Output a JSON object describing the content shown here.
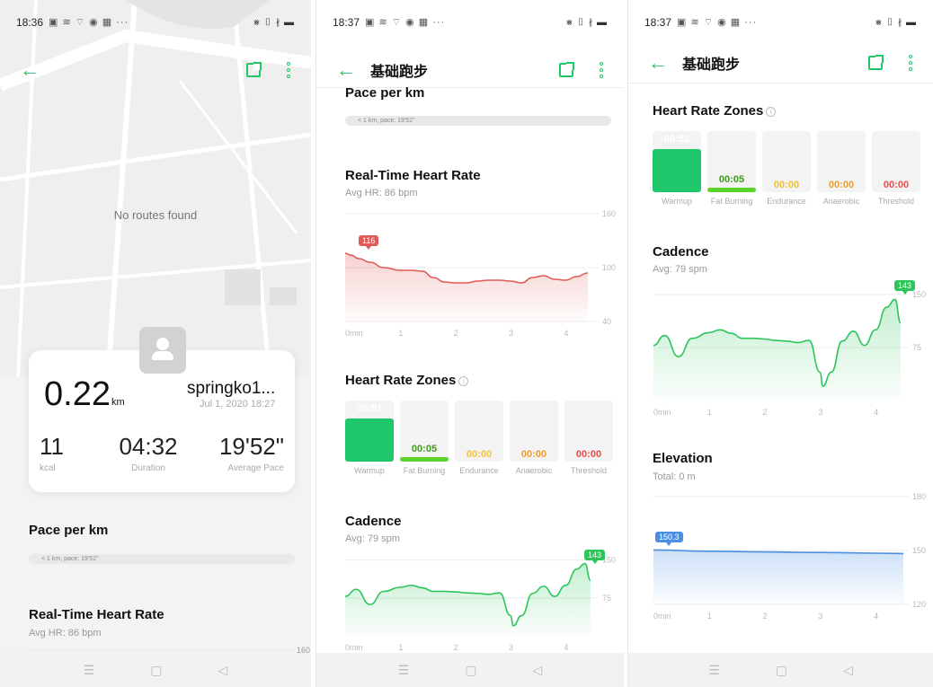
{
  "status": {
    "s1_time": "18:36",
    "s2_time": "18:37",
    "s3_time": "18:37",
    "left_icons": "▣ ≋ ⌔ ◉ ▦ ···",
    "right_icons": "⨳ ▯ ∦ ▬"
  },
  "nav": {
    "title": "基础跑步"
  },
  "map": {
    "no_routes": "No routes found"
  },
  "summary": {
    "distance": "0.22",
    "distance_unit": "km",
    "username": "springko1...",
    "date": "Jul 1, 2020 18:27",
    "kcal_value": "11",
    "kcal_label": "kcal",
    "duration_value": "04:32",
    "duration_label": "Duration",
    "pace_value": "19'52\"",
    "pace_label": "Average Pace"
  },
  "pace": {
    "title": "Pace per km",
    "bar_text": "< 1 km, pace: 19'52\""
  },
  "heart_rate": {
    "title": "Real-Time Heart Rate",
    "avg": "Avg HR: 86 bpm",
    "max_label": "116"
  },
  "zones": {
    "title": "Heart Rate Zones",
    "info": "i",
    "items": [
      {
        "value": "00:51",
        "label": "Warmup",
        "color": "#1ec76a",
        "fraction": 0.7
      },
      {
        "value": "00:05",
        "label": "Fat Burning",
        "color": "#5bd32a",
        "fraction": 0.07
      },
      {
        "value": "00:00",
        "label": "Endurance",
        "color": "#f2c233",
        "fraction": 0
      },
      {
        "value": "00:00",
        "label": "Anaerobic",
        "color": "#f29b2a",
        "fraction": 0
      },
      {
        "value": "00:00",
        "label": "Threshold",
        "color": "#ee4b4b",
        "fraction": 0
      }
    ]
  },
  "cadence": {
    "title": "Cadence",
    "avg": "Avg: 79 spm",
    "max_label": "143"
  },
  "elevation": {
    "title": "Elevation",
    "total": "Total: 0 m",
    "start_label": "150.3"
  },
  "chart_data": [
    {
      "type": "line",
      "title": "Real-Time Heart Rate",
      "x_ticks": [
        "0min",
        "1",
        "2",
        "3",
        "4"
      ],
      "y_ticks": [
        "160",
        "100",
        "40"
      ],
      "ylim": [
        40,
        160
      ],
      "xlim": [
        0,
        4.5
      ],
      "color": "#e05a57",
      "x": [
        0,
        0.1,
        0.25,
        0.45,
        0.7,
        1.0,
        1.2,
        1.4,
        1.6,
        1.8,
        2.0,
        2.2,
        2.4,
        2.6,
        2.8,
        3.0,
        3.2,
        3.4,
        3.6,
        3.8,
        4.0,
        4.2,
        4.4
      ],
      "y": [
        116,
        114,
        110,
        106,
        100,
        97,
        97,
        96,
        89,
        84,
        83,
        83,
        85,
        86,
        86,
        85,
        83,
        89,
        91,
        87,
        86,
        90,
        94
      ]
    },
    {
      "type": "line",
      "title": "Cadence",
      "x_ticks": [
        "0min",
        "1",
        "2",
        "3",
        "4"
      ],
      "y_ticks": [
        "150",
        "75"
      ],
      "ylim": [
        0,
        160
      ],
      "xlim": [
        0,
        4.5
      ],
      "color": "#2cc55a",
      "x": [
        0,
        0.2,
        0.45,
        0.7,
        1.0,
        1.2,
        1.4,
        1.6,
        1.8,
        2.0,
        2.2,
        2.4,
        2.6,
        2.8,
        3.0,
        3.05,
        3.2,
        3.4,
        3.6,
        3.8,
        4.0,
        4.2,
        4.35,
        4.45
      ],
      "y": [
        78,
        92,
        62,
        88,
        96,
        100,
        95,
        88,
        88,
        87,
        85,
        84,
        82,
        85,
        40,
        20,
        40,
        84,
        98,
        78,
        100,
        132,
        143,
        110
      ]
    },
    {
      "type": "line",
      "title": "Elevation",
      "x_ticks": [
        "0min",
        "1",
        "2",
        "3",
        "4"
      ],
      "y_ticks": [
        "180",
        "150",
        "120"
      ],
      "ylim": [
        120,
        180
      ],
      "xlim": [
        0,
        4.5
      ],
      "color": "#4a90e2",
      "x": [
        0,
        1,
        2,
        3,
        4,
        4.5
      ],
      "y": [
        150.3,
        149.6,
        149.2,
        148.9,
        148.5,
        148.3
      ]
    }
  ]
}
